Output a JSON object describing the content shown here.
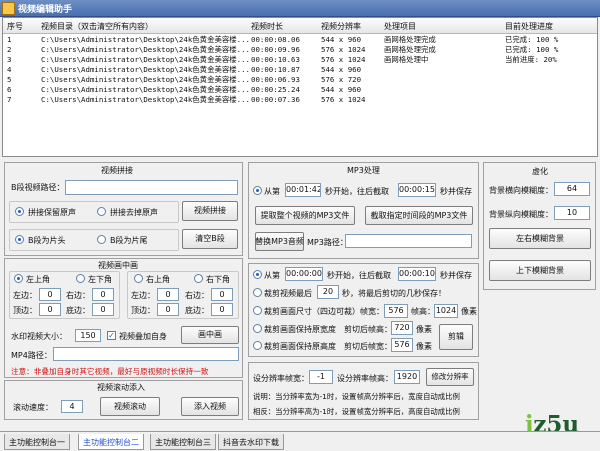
{
  "window": {
    "title": "视频编辑助手"
  },
  "table": {
    "headers": [
      "序号",
      "视频目录（双击清空所有内容）",
      "视频时长",
      "视频分辨率",
      "处理项目",
      "目前处理进度"
    ],
    "rows": [
      [
        "1",
        "C:\\Users\\Administrator\\Desktop\\24k色黄金美容楼...",
        "00:00:08.06",
        "544 x 960",
        "画网格处理完成",
        "已完成: 100 %"
      ],
      [
        "2",
        "C:\\Users\\Administrator\\Desktop\\24k色黄金美容楼...",
        "00:00:09.96",
        "576 x 1024",
        "画网格处理完成",
        "已完成: 100 %"
      ],
      [
        "3",
        "C:\\Users\\Administrator\\Desktop\\24k色黄金美容楼...",
        "00:00:10.63",
        "576 x 1024",
        "画网格处理中",
        "当前进度: 20%"
      ],
      [
        "4",
        "C:\\Users\\Administrator\\Desktop\\24k色黄金美容楼...",
        "00:00:10.87",
        "544 x 960",
        "",
        ""
      ],
      [
        "5",
        "C:\\Users\\Administrator\\Desktop\\24k色黄金美容楼...",
        "00:00:06.93",
        "576 x 720",
        "",
        ""
      ],
      [
        "6",
        "C:\\Users\\Administrator\\Desktop\\24k色黄金美容楼...",
        "00:00:25.24",
        "544 x 960",
        "",
        ""
      ],
      [
        "7",
        "C:\\Users\\Administrator\\Desktop\\24k色黄金美容楼...",
        "00:00:07.36",
        "576 x 1024",
        "",
        ""
      ]
    ]
  },
  "splice": {
    "title": "视频拼接",
    "b_path_label": "B段视频路径：",
    "opt_keep_audio": "拼接保留原声",
    "opt_remove_audio": "拼接去掉原声",
    "splice_button": "视频拼接",
    "opt_head": "B段为片头",
    "opt_tail": "B段为片尾",
    "clear_button": "清空B段"
  },
  "pip": {
    "title": "视频画中画",
    "top_left": "左上角",
    "bottom_left": "左下角",
    "top_right": "右上角",
    "bottom_right": "右下角",
    "left_l": "左边：",
    "left_v": "0",
    "right_l": "右边：",
    "right_v": "0",
    "top_l": "顶边：",
    "top_v": "0",
    "bottom_l": "底边：",
    "bottom_v": "0",
    "left2_l": "左边：",
    "left2_v": "0",
    "right2_l": "右边：",
    "right2_v": "0",
    "top2_l": "顶边：",
    "top2_v": "0",
    "bottom2_l": "底边：",
    "bottom2_v": "0",
    "wm_size_label": "水印视频大小：",
    "wm_size": "150",
    "overlay_self": "视频叠加自身",
    "pip_button": "画中画",
    "mp4_label": "MP4路径：",
    "note": "注意：非叠加自身时其它视频，最好与原视频时长保持一致"
  },
  "scroll": {
    "title": "视频滚动添入",
    "speed_label": "滚动速度：",
    "speed": "4",
    "scroll_button": "视频滚动",
    "add_button": "添入视频"
  },
  "mp3": {
    "title": "MP3处理",
    "from_label": "从第",
    "start": "00:01:42",
    "mid_label": "秒开始，往后截取",
    "len": "00:00:15",
    "save_label": "秒并保存",
    "extract_all": "提取整个视频的MP3文件",
    "extract_range": "截取指定时间段的MP3文件",
    "replace_button": "替换MP3音频",
    "mp3_path_label": "MP3路径："
  },
  "crop": {
    "from_label": "从第",
    "start": "00:00:00",
    "mid_label": "秒开始，往后截取",
    "len": "00:00:10",
    "save_label": "秒并保存",
    "cut_last_a": "裁剪视频最后",
    "cut_last_v": "20",
    "cut_last_b": "秒，将最后剪切的几秒保存！",
    "size_label": "裁剪画面尺寸（四边可裁）帧宽：",
    "fw": "576",
    "fh_label": "帧高：",
    "fh": "1024",
    "px": "像素",
    "keep_w_label": "裁剪画面保持原宽度",
    "cut_h_label": "剪切后帧高：",
    "cut_h": "720",
    "px2": "像素",
    "keep_h_label": "裁剪画面保持原高度",
    "cut_w_label": "剪切后帧宽：",
    "cut_w": "576",
    "px3": "像素",
    "crop_button": "剪辑"
  },
  "res": {
    "w_label": "设分辨率帧宽：",
    "w": "-1",
    "h_label": "设分辨率帧高：",
    "h": "1920",
    "button": "修改分辨率",
    "note1": "说明：当分辨率宽为-1时，设置帧高分辨率后，宽度自动成比例",
    "note2": "相反：当分辨率高为-1时，设置帧宽分辨率后，高度自动成比例"
  },
  "blur": {
    "title": "虚化",
    "h_label": "背景横向模糊度：",
    "h": "64",
    "v_label": "背景纵向模糊度：",
    "v": "10",
    "lr_button": "左右模糊背景",
    "tb_button": "上下模糊背景"
  },
  "tabs": [
    "主功能控制台一",
    "主功能控制台二",
    "主功能控制台三",
    "抖音去水印下载"
  ],
  "logo": {
    "left": "j",
    "rest": "z5u",
    "sub": "jz5u"
  }
}
